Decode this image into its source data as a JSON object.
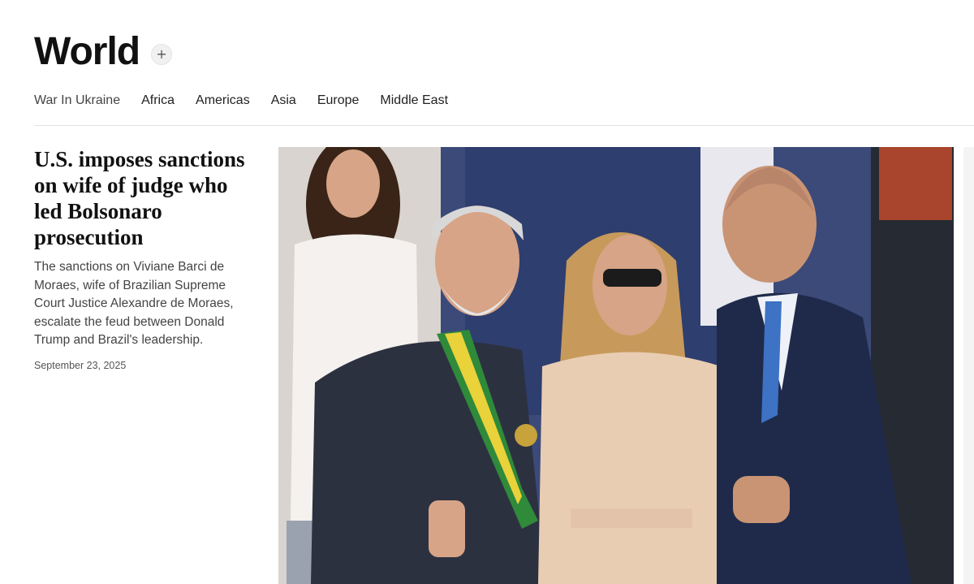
{
  "section": {
    "title": "World",
    "follow_symbol": "+"
  },
  "subnav": {
    "items": [
      "War In Ukraine",
      "Africa",
      "Americas",
      "Asia",
      "Europe",
      "Middle East"
    ]
  },
  "story": {
    "headline": "U.S. imposes sanctions on wife of judge who led Bolsonaro prosecution",
    "summary": "The sanctions on Viviane Barci de Moraes, wife of Brazilian Supreme Court Justice Alexandre de Moraes, escalate the feud between Donald Trump and Brazil's leadership.",
    "date": "September 23, 2025"
  },
  "photo": {
    "colors": {
      "background": "#3b4a78",
      "suit_dark": "#2c3140",
      "suit_navy": "#1f2a4a",
      "dress": "#e9cdb3",
      "sash_green": "#2f8a3a",
      "sash_yellow": "#e9d23a",
      "skin": "#d7a487",
      "hair_blonde": "#c79a5b",
      "hair_dark": "#3a2418",
      "hair_gray": "#d8d8d8"
    }
  }
}
